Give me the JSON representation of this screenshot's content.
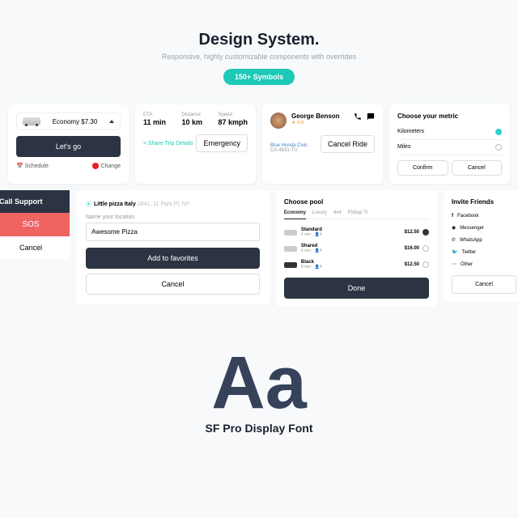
{
  "hero": {
    "title": "Design System.",
    "sub": "Responsive, highly customizable components with overrides",
    "pill": "150+ Symbols"
  },
  "card1": {
    "economy": "Economy $7.30",
    "go": "Let's go",
    "schedule": "Schedule",
    "change": "Change"
  },
  "card2": {
    "eta_l": "ETA",
    "eta": "11 min",
    "dist_l": "Distance",
    "dist": "10 km",
    "spd_l": "Speed",
    "spd": "87 kmph",
    "share": "Share Trip Details",
    "emerg": "Emergency"
  },
  "card3": {
    "name": "George Benson",
    "rating": "★ 4.8",
    "car": "Blue Honda Civic",
    "plate": "CA-4831-TU",
    "cancel": "Cancel Ride"
  },
  "card4": {
    "title": "Choose your metric",
    "o1": "Kilometers",
    "o2": "Miles",
    "confirm": "Confirm",
    "cancel": "Cancel"
  },
  "sos": {
    "call": "Call Support",
    "sos": "SOS",
    "cancel": "Cancel"
  },
  "fav": {
    "loc": "Little pizza Italy",
    "addr": "2841, 11 Park Pl, NY",
    "label": "Name your location",
    "val": "Awesome Pizza",
    "add": "Add to favorites",
    "cancel": "Cancel"
  },
  "pool": {
    "title": "Choose pool",
    "t1": "Economy",
    "t2": "Luxury",
    "t3": "4x4",
    "t4": "Pickup Tr",
    "o1": "Standard",
    "o1m": "4 min · 👤4",
    "o1p": "$12.50",
    "o2": "Shared",
    "o2m": "6 min · 👤4",
    "o2p": "$16.00",
    "o3": "Black",
    "o3m": "8 min · 👤4",
    "o3p": "$12.50",
    "done": "Done"
  },
  "inv": {
    "title": "Invite Friends",
    "i1": "Facebook",
    "i2": "Messenger",
    "i3": "WhatsApp",
    "i4": "Twitter",
    "i5": "Other",
    "cancel": "Cancel"
  },
  "typo": {
    "aa": "Aa",
    "font": "SF Pro Display Font"
  }
}
